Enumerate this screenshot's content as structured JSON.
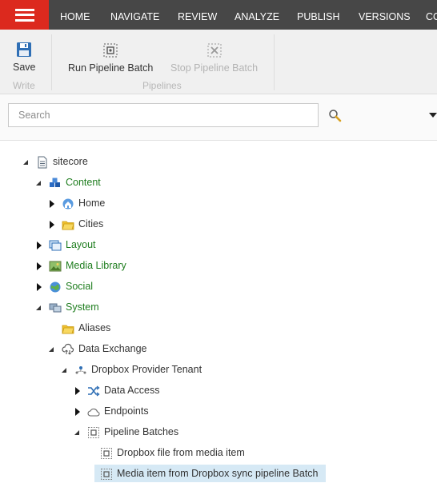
{
  "nav": {
    "tabs": [
      "HOME",
      "NAVIGATE",
      "REVIEW",
      "ANALYZE",
      "PUBLISH",
      "VERSIONS",
      "CO"
    ]
  },
  "ribbon": {
    "save_label": "Save",
    "write_group": "Write",
    "run_label": "Run Pipeline Batch",
    "stop_label": "Stop Pipeline Batch",
    "pipelines_group": "Pipelines"
  },
  "search": {
    "placeholder": "Search"
  },
  "tree": {
    "sitecore": "sitecore",
    "content": "Content",
    "home": "Home",
    "cities": "Cities",
    "layout": "Layout",
    "media_library": "Media Library",
    "social": "Social",
    "system": "System",
    "aliases": "Aliases",
    "data_exchange": "Data Exchange",
    "dropbox_tenant": "Dropbox Provider Tenant",
    "data_access": "Data Access",
    "endpoints": "Endpoints",
    "pipeline_batches": "Pipeline Batches",
    "dropbox_file": "Dropbox file from media item",
    "media_item_sync": "Media item from Dropbox sync pipeline Batch"
  },
  "colors": {
    "menu_red": "#dc291e",
    "topbar": "#474747",
    "selected": "#d6e9f5",
    "green_label": "#1e7d1e"
  }
}
